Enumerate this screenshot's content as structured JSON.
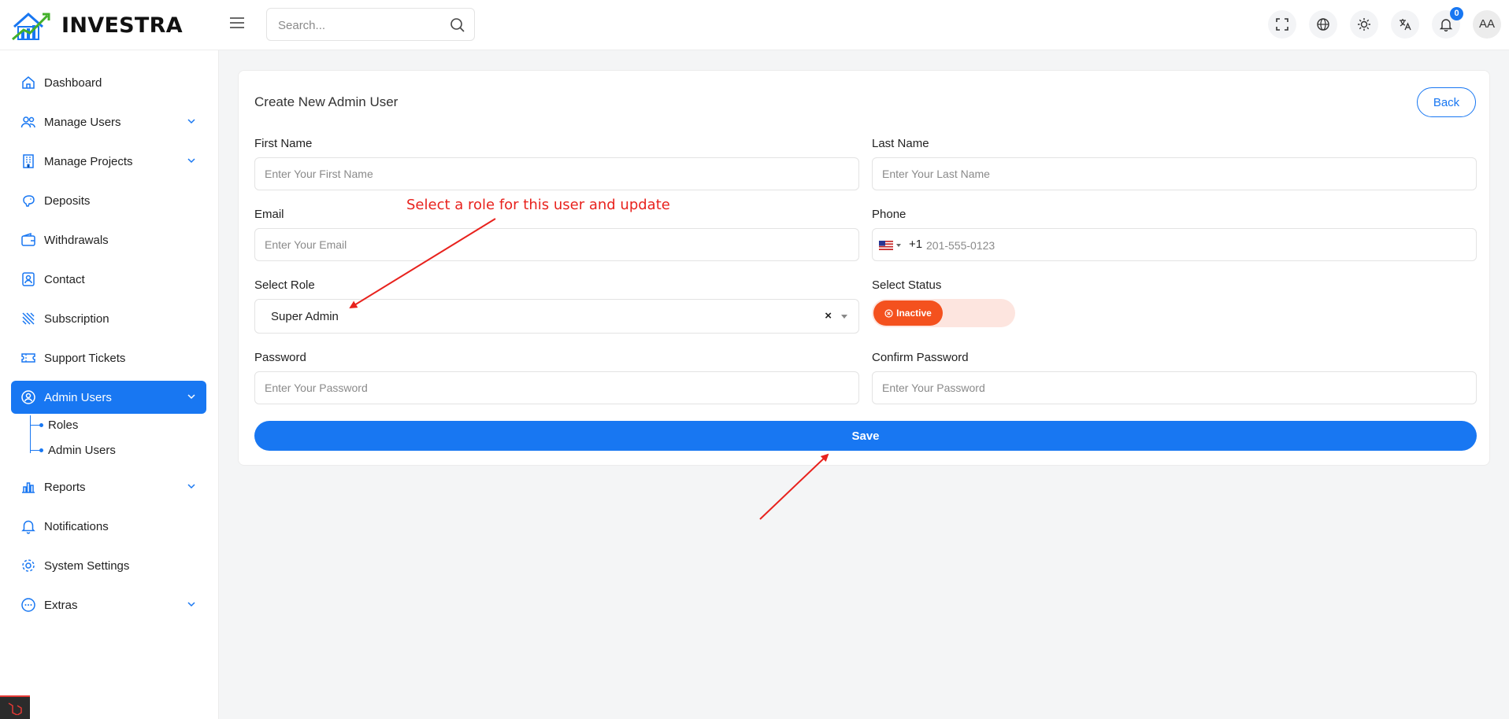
{
  "app": {
    "name": "INVESTRA"
  },
  "search": {
    "placeholder": "Search..."
  },
  "topbar": {
    "notification_count": "0",
    "avatar_initials": "AA"
  },
  "sidebar": {
    "items": [
      {
        "label": "Dashboard"
      },
      {
        "label": "Manage Users"
      },
      {
        "label": "Manage Projects"
      },
      {
        "label": "Deposits"
      },
      {
        "label": "Withdrawals"
      },
      {
        "label": "Contact"
      },
      {
        "label": "Subscription"
      },
      {
        "label": "Support Tickets"
      },
      {
        "label": "Admin Users"
      },
      {
        "label": "Reports"
      },
      {
        "label": "Notifications"
      },
      {
        "label": "System Settings"
      },
      {
        "label": "Extras"
      }
    ],
    "admin_subitems": [
      {
        "label": "Roles"
      },
      {
        "label": "Admin Users"
      }
    ]
  },
  "form": {
    "title": "Create New Admin User",
    "back_label": "Back",
    "first_name": {
      "label": "First Name",
      "placeholder": "Enter Your First Name"
    },
    "last_name": {
      "label": "Last Name",
      "placeholder": "Enter Your Last Name"
    },
    "email": {
      "label": "Email",
      "placeholder": "Enter Your Email"
    },
    "phone": {
      "label": "Phone",
      "country_code": "+1",
      "placeholder": "201-555-0123"
    },
    "role": {
      "label": "Select Role",
      "value": "Super Admin",
      "clear": "×"
    },
    "status": {
      "label": "Select Status",
      "value": "Inactive"
    },
    "password": {
      "label": "Password",
      "placeholder": "Enter Your Password"
    },
    "confirm_password": {
      "label": "Confirm Password",
      "placeholder": "Enter Your Password"
    },
    "save_label": "Save"
  },
  "annotation": {
    "text": "Select a role for this user and update"
  },
  "colors": {
    "primary": "#1877f2",
    "danger": "#f4511e",
    "annotation": "#e8221d"
  }
}
